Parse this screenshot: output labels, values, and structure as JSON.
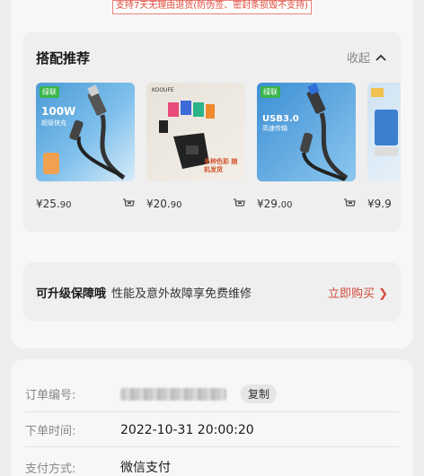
{
  "return_policy": "支持7天无理由退货(防伪签、密封条损毁不支持)",
  "recommendations": {
    "title": "搭配推荐",
    "collapse_label": "收起",
    "products": [
      {
        "brand": "绿联",
        "headline": "100W",
        "subline": "超级快充",
        "price_main": "¥25.",
        "price_cents": "90"
      },
      {
        "brand": "KOOUFE",
        "caption": "多种色彩 随机发货",
        "price_main": "¥20.",
        "price_cents": "90"
      },
      {
        "brand": "绿联",
        "headline": "USB3.0",
        "subline": "高速传输",
        "price_main": "¥29.",
        "price_cents": "00"
      },
      {
        "brand": "",
        "price_main": "¥9.9",
        "price_cents": ""
      }
    ]
  },
  "warranty": {
    "title": "可升级保障哦",
    "description": "性能及意外故障享免费维修",
    "action": "立即购买 ❯"
  },
  "order_info": {
    "order_no_label": "订单编号:",
    "copy_label": "复制",
    "time_label": "下单时间:",
    "time_value": "2022-10-31 20:00:20",
    "payment_label": "支付方式:",
    "payment_value": "微信支付"
  }
}
